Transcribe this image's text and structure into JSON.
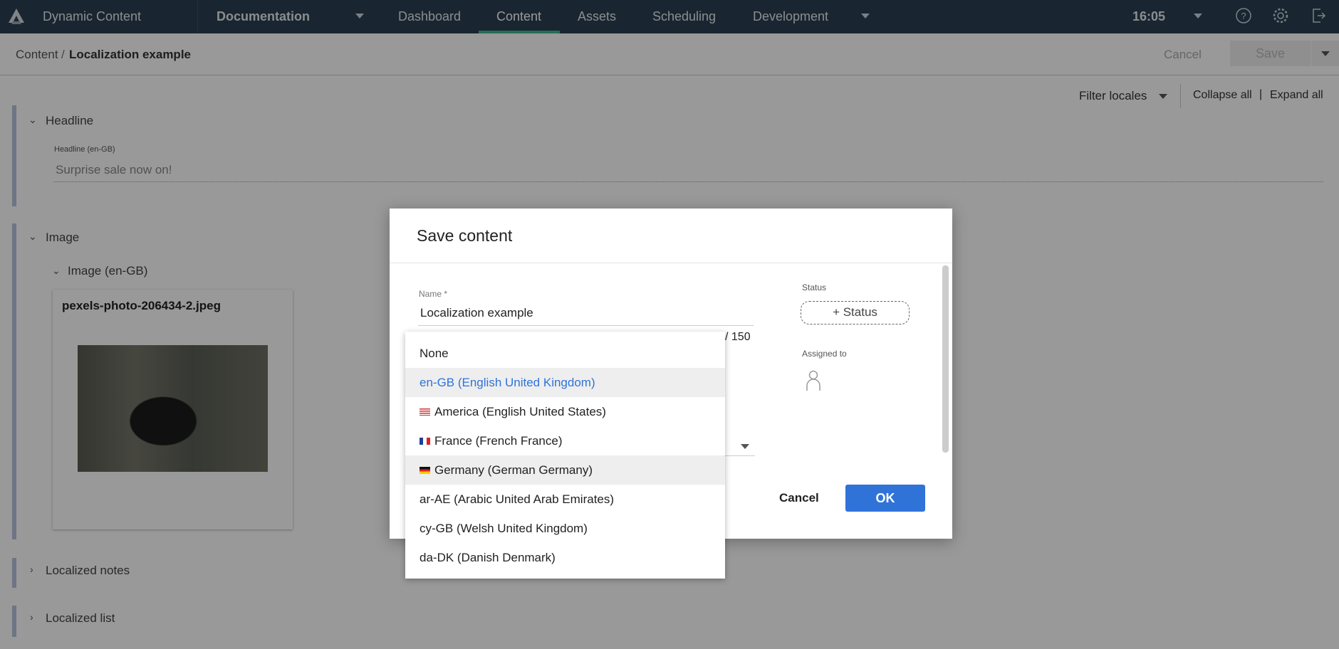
{
  "topbar": {
    "app_name": "Dynamic Content",
    "hub": "Documentation",
    "nav": [
      "Dashboard",
      "Content",
      "Assets",
      "Scheduling",
      "Development"
    ],
    "active_nav": "Content",
    "time": "16:05",
    "accent": "#3fb58e"
  },
  "breadcrumb": {
    "root": "Content",
    "separator": "/",
    "current": "Localization example"
  },
  "actions": {
    "cancel": "Cancel",
    "save": "Save"
  },
  "toolbar": {
    "filter": "Filter locales",
    "collapse": "Collapse all",
    "separator": "|",
    "expand": "Expand all"
  },
  "sections": {
    "headline": {
      "title": "Headline",
      "field_label": "Headline (en-GB)",
      "field_value": "Surprise sale now on!"
    },
    "image": {
      "title": "Image",
      "sub_title": "Image (en-GB)",
      "filename": "pexels-photo-206434-2.jpeg"
    },
    "notes": {
      "title": "Localized notes"
    },
    "list": {
      "title": "Localized list"
    }
  },
  "modal": {
    "title": "Save content",
    "name_label": "Name *",
    "name_value": "Localization example",
    "char_limit": "/ 150",
    "status_label": "Status",
    "status_button": "+ Status",
    "assigned_label": "Assigned to",
    "cancel": "Cancel",
    "ok": "OK",
    "ok_color": "#2f73d9"
  },
  "dropdown": {
    "selected": "en-GB (English United Kingdom)",
    "items": [
      {
        "label": "None"
      },
      {
        "label": "en-GB (English United Kingdom)"
      },
      {
        "label": "America (English United States)",
        "flag": "us"
      },
      {
        "label": "France (French France)",
        "flag": "fr"
      },
      {
        "label": "Germany (German Germany)",
        "flag": "de"
      },
      {
        "label": "ar-AE (Arabic United Arab Emirates)"
      },
      {
        "label": "cy-GB (Welsh United Kingdom)"
      },
      {
        "label": "da-DK (Danish Denmark)"
      }
    ]
  }
}
